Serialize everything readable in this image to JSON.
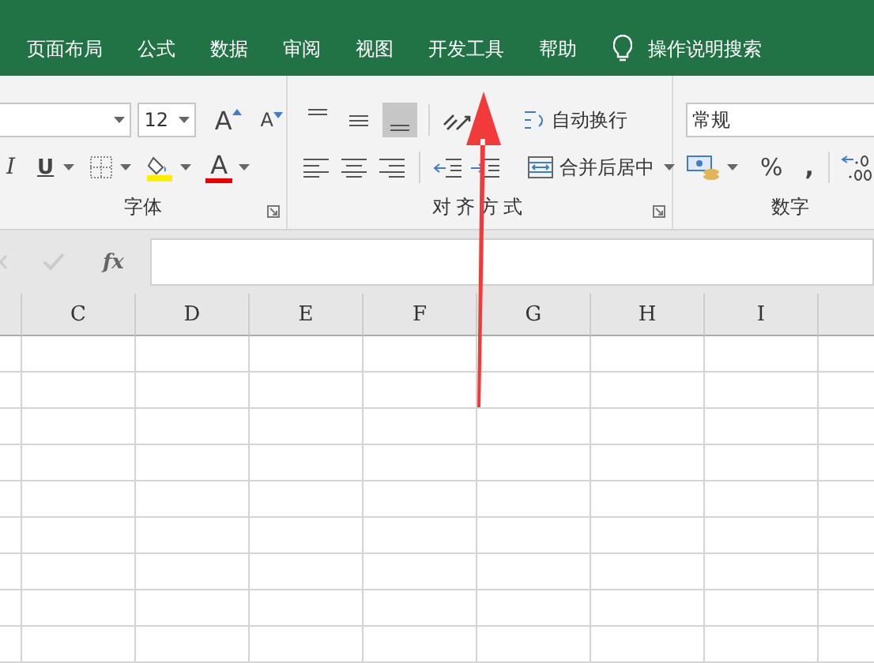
{
  "tabs": [
    {
      "label": "页面布局",
      "selected": false
    },
    {
      "label": "公式",
      "selected": false
    },
    {
      "label": "数据",
      "selected": false
    },
    {
      "label": "审阅",
      "selected": false
    },
    {
      "label": "视图",
      "selected": false
    },
    {
      "label": "开发工具",
      "selected": false
    },
    {
      "label": "帮助",
      "selected": false
    }
  ],
  "tell_me": "操作说明搜索",
  "font_group": {
    "label": "字体",
    "font_size": "12",
    "grow_glyph": "A",
    "shrink_glyph": "A",
    "italic_glyph": "I",
    "underline_glyph": "U",
    "font_color_glyph": "A"
  },
  "alignment_group": {
    "label": "对齐方式",
    "vertical_align": [
      {
        "selected": false
      },
      {
        "selected": false
      },
      {
        "selected": true
      }
    ],
    "wrap_text": "自动换行",
    "merge_center": "合并后居中"
  },
  "number_group": {
    "label": "数字",
    "format": "常规",
    "percent": "%",
    "comma": ","
  },
  "formula_bar": {
    "fx": "fx"
  },
  "columns": [
    "C",
    "D",
    "E",
    "F",
    "G",
    "H",
    "I"
  ]
}
